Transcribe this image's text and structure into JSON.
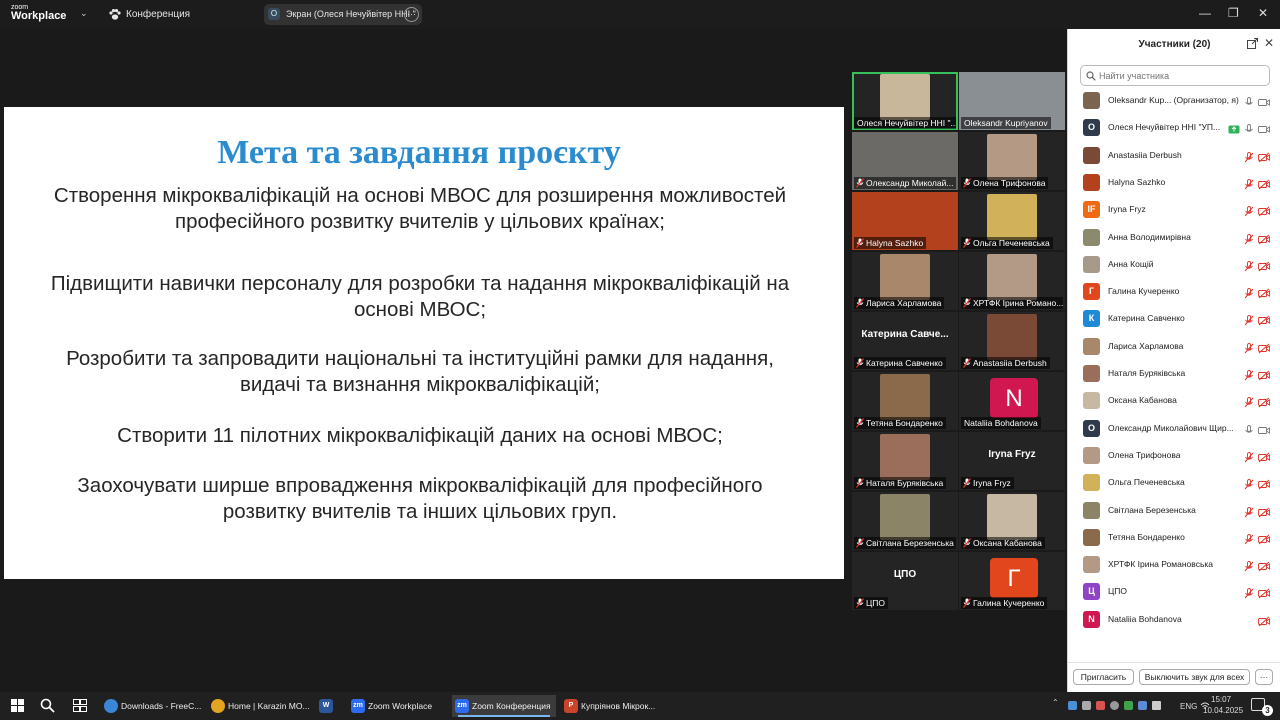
{
  "app": {
    "logo_line1": "zoom",
    "logo_line2": "Workplace",
    "meeting_label": "Конференция",
    "share_avatar": "О",
    "share_label": "Экран (Олеся Нечуйвітер ННІ \"",
    "minimize": "—",
    "restore": "❐",
    "close": "✕"
  },
  "slide": {
    "title": "Мета та завдання проєкту",
    "bullets": [
      "Створення мікрокваліфікацій на основі МВОС для розширення можливостей професійного розвитку вчителів у цільових країнах;",
      "Підвищити навички персоналу для розробки та надання мікрокваліфікацій на основі МВОС;",
      "Розробити та запровадити національні та інституційні рамки для надання, видачі та визнання мікрокваліфікацій;",
      "Створити 11 пілотних мікрокваліфікацій даних на основі МВОС;",
      "Заохочувати ширше впровадження мікрокваліфікацій для професійного розвитку вчителів та інших цільових груп."
    ]
  },
  "tiles": [
    {
      "caption": "Олеся Нечуйвітер ННІ \"...",
      "type": "photo",
      "muted": false,
      "active": true,
      "color": "#c9b79b"
    },
    {
      "caption": "Oleksandr Kupriyanov",
      "type": "photo",
      "muted": false,
      "wide": true,
      "color": "#8a8f94"
    },
    {
      "caption": "Олександр Миколай...",
      "type": "photo",
      "muted": true,
      "wide": true,
      "color": "#6c6a66"
    },
    {
      "caption": "Олена Трифонова",
      "type": "photo",
      "muted": true,
      "color": "#b49a84"
    },
    {
      "caption": "Halyna Sazhko",
      "type": "photo",
      "muted": true,
      "wide": true,
      "color": "#b4411e"
    },
    {
      "caption": "Ольга Печеневська",
      "type": "photo",
      "muted": true,
      "color": "#d1b15a"
    },
    {
      "caption": "Лариса Харламова",
      "type": "photo",
      "muted": true,
      "color": "#a8876b"
    },
    {
      "caption": "ХРТФК Ірина Романо...",
      "type": "photo",
      "muted": true,
      "color": "#b39a86"
    },
    {
      "caption": "Катерина Савченко",
      "type": "name",
      "big": "Катерина Савче...",
      "muted": true
    },
    {
      "caption": "Anastasiia Derbush",
      "type": "photo",
      "muted": true,
      "color": "#7a4a36"
    },
    {
      "caption": "Тетяна Бондаренко",
      "type": "photo",
      "muted": true,
      "color": "#8a6a4a"
    },
    {
      "caption": "Nataliia Bohdanova",
      "type": "letter",
      "letter": "N",
      "muted": false,
      "color": "#d0174f"
    },
    {
      "caption": "Наталя Буряківська",
      "type": "photo",
      "muted": true,
      "color": "#9a6e5a"
    },
    {
      "caption": "Iryna Fryz",
      "type": "name",
      "big": "Iryna Fryz",
      "muted": true
    },
    {
      "caption": "Світлана Березенська",
      "type": "photo",
      "muted": true,
      "color": "#8c8466"
    },
    {
      "caption": "Оксана Кабанова",
      "type": "photo",
      "muted": true,
      "color": "#c7b8a4"
    },
    {
      "caption": "ЦПО",
      "type": "name",
      "big": "ЦПО",
      "muted": true
    },
    {
      "caption": "Галина Кучеренко",
      "type": "letter",
      "letter": "Г",
      "muted": true,
      "color": "#e2461c"
    }
  ],
  "panel": {
    "title": "Участники (20)",
    "close": "✕",
    "search_placeholder": "Найти участника",
    "participants": [
      {
        "name": "Oleksandr Kup... (Организатор, я)",
        "avatar": "",
        "color": "#7a6450",
        "mic": "on",
        "cam": "off"
      },
      {
        "name": "Олеся Нечуйвітер ННІ \"УП...",
        "avatar": "О",
        "color": "#2f3b4a",
        "mic": "on",
        "cam": "on",
        "sharing": true
      },
      {
        "name": "Anastasiia Derbush",
        "avatar": "",
        "color": "#7a4a36",
        "mic": "muted",
        "cam": "muted"
      },
      {
        "name": "Halyna Sazhko",
        "avatar": "",
        "color": "#b4411e",
        "mic": "muted",
        "cam": "muted"
      },
      {
        "name": "Iryna Fryz",
        "avatar": "IF",
        "color": "#f06a14",
        "mic": "muted",
        "cam": "muted"
      },
      {
        "name": "Анна Володимирівна",
        "avatar": "",
        "color": "#8c8a6e",
        "mic": "muted",
        "cam": "muted"
      },
      {
        "name": "Анна Кощій",
        "avatar": "",
        "color": "#a89a8a",
        "mic": "muted",
        "cam": "muted"
      },
      {
        "name": "Галина Кучеренко",
        "avatar": "Г",
        "color": "#e2461c",
        "mic": "muted",
        "cam": "muted"
      },
      {
        "name": "Катерина Савченко",
        "avatar": "К",
        "color": "#1d8ad6",
        "mic": "muted",
        "cam": "muted"
      },
      {
        "name": "Лариса Харламова",
        "avatar": "",
        "color": "#a8876b",
        "mic": "muted",
        "cam": "muted"
      },
      {
        "name": "Наталя Буряківська",
        "avatar": "",
        "color": "#9a6e5a",
        "mic": "muted",
        "cam": "muted"
      },
      {
        "name": "Оксана Кабанова",
        "avatar": "",
        "color": "#c7b8a4",
        "mic": "muted",
        "cam": "muted"
      },
      {
        "name": "Олександр Миколайович Щир...",
        "avatar": "О",
        "color": "#2f3b4a",
        "mic": "on",
        "cam": "off"
      },
      {
        "name": "Олена Трифонова",
        "avatar": "",
        "color": "#b49a84",
        "mic": "muted",
        "cam": "muted"
      },
      {
        "name": "Ольга Печеневська",
        "avatar": "",
        "color": "#d1b15a",
        "mic": "muted",
        "cam": "muted"
      },
      {
        "name": "Світлана Березенська",
        "avatar": "",
        "color": "#8c8466",
        "mic": "muted",
        "cam": "muted"
      },
      {
        "name": "Тетяна Бондаренко",
        "avatar": "",
        "color": "#8a6a4a",
        "mic": "muted",
        "cam": "muted"
      },
      {
        "name": "ХРТФК Ірина Романовська",
        "avatar": "",
        "color": "#b39a86",
        "mic": "muted",
        "cam": "muted"
      },
      {
        "name": "ЦПО",
        "avatar": "Ц",
        "color": "#8e44c4",
        "mic": "muted",
        "cam": "muted"
      },
      {
        "name": "Nataliia Bohdanova",
        "avatar": "N",
        "color": "#d0174f",
        "mic": "none",
        "cam": "muted"
      }
    ],
    "invite_label": "Пригласить",
    "mute_all_label": "Выключить звук для всех",
    "more_label": "···"
  },
  "taskbar": {
    "items": [
      {
        "label": "Downloads - FreeC...",
        "color": "#3a86d8",
        "active": false
      },
      {
        "label": "Home | Karazin MO...",
        "color": "#e4a423",
        "active": false
      },
      {
        "label": "",
        "color": "#2b579a",
        "active": false,
        "glyph": "W"
      },
      {
        "label": "Zoom Workplace",
        "color": "#2d6cf0",
        "active": false,
        "glyph": "zm"
      },
      {
        "label": "Zoom Конференция",
        "color": "#2d6cf0",
        "active": true,
        "glyph": "zm"
      },
      {
        "label": "Купріянов Мікрок...",
        "color": "#c9442a",
        "active": false,
        "glyph": "P"
      }
    ],
    "lang": "ENG",
    "time": "15:07",
    "date": "10.04.2025",
    "notif": "3"
  },
  "colors": {
    "accent": "#2a8ccf",
    "active_speaker": "#37c15b",
    "muted_red": "#e0332a"
  }
}
